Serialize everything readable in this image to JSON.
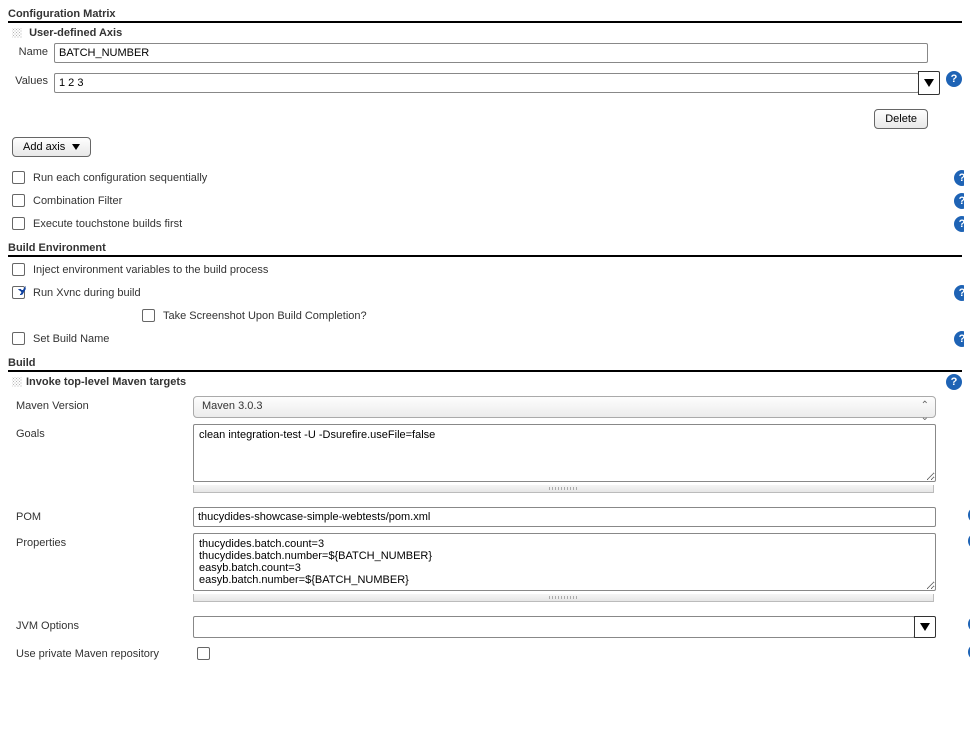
{
  "configMatrix": {
    "heading": "Configuration Matrix",
    "axis": {
      "title": "User-defined Axis",
      "nameLabel": "Name",
      "nameValue": "BATCH_NUMBER",
      "valuesLabel": "Values",
      "valuesValue": "1 2 3"
    },
    "deleteBtn": "Delete",
    "addAxisBtn": "Add axis",
    "options": {
      "runSequential": "Run each configuration sequentially",
      "combinationFilter": "Combination Filter",
      "touchstone": "Execute touchstone builds first"
    }
  },
  "buildEnv": {
    "heading": "Build Environment",
    "injectVars": "Inject environment variables to the build process",
    "runXvnc": "Run Xvnc during build",
    "screenshot": "Take Screenshot Upon Build Completion?",
    "setBuildName": "Set Build Name"
  },
  "build": {
    "heading": "Build",
    "mavenStep": {
      "title": "Invoke top-level Maven targets",
      "versionLabel": "Maven Version",
      "versionValue": "Maven 3.0.3",
      "goalsLabel": "Goals",
      "goalsValue": "clean integration-test -U -Dsurefire.useFile=false",
      "pomLabel": "POM",
      "pomValue": "thucydides-showcase-simple-webtests/pom.xml",
      "propsLabel": "Properties",
      "propsValue": "thucydides.batch.count=3\nthucydides.batch.number=${BATCH_NUMBER}\neasyb.batch.count=3\neasyb.batch.number=${BATCH_NUMBER}",
      "jvmLabel": "JVM Options",
      "jvmValue": "",
      "privateRepoLabel": "Use private Maven repository"
    }
  }
}
